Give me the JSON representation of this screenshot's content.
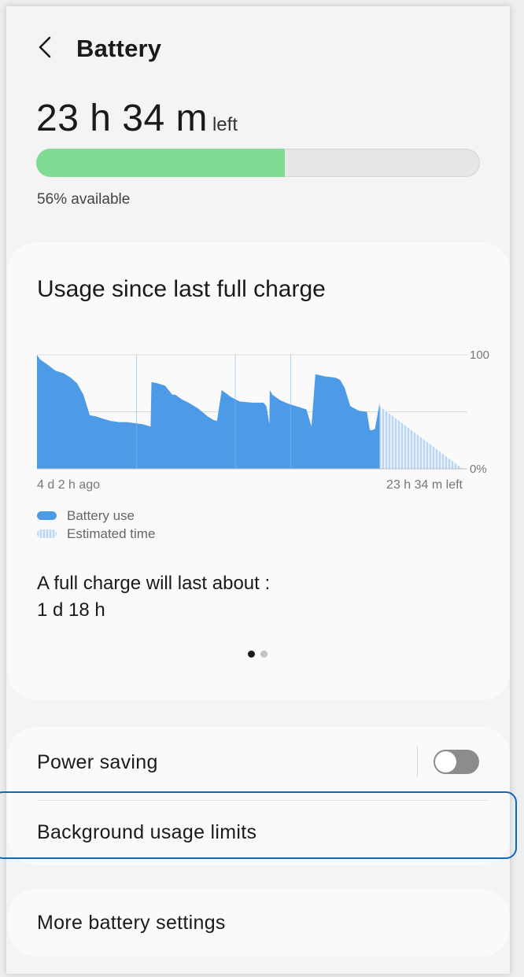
{
  "header": {
    "title": "Battery",
    "back_icon": "chevron-left-icon"
  },
  "battery": {
    "time_left_value": "23 h 34 m",
    "time_left_suffix": "left",
    "percent": 56,
    "available_text": "56% available",
    "fill_color": "#80dc92"
  },
  "usage": {
    "title": "Usage since last full charge",
    "full_charge_label": "A full charge will last about :",
    "full_charge_value": "1 d 18 h",
    "page_dots": {
      "count": 2,
      "active": 0
    }
  },
  "chart_data": {
    "type": "area",
    "y_tick_labels": [
      "100",
      "0%"
    ],
    "ylim": [
      0,
      100
    ],
    "gridlines": [
      0,
      50,
      100
    ],
    "x_start_label": "4 d 2 h ago",
    "x_end_label": "23 h 34 m left",
    "xlim": [
      0,
      100
    ],
    "series": [
      {
        "name": "Battery use",
        "color": "#4d9be6",
        "x": [
          0,
          0.7,
          2.6,
          4.3,
          6.2,
          7.9,
          9.4,
          10.9,
          12.4,
          13.8,
          15.5,
          17.3,
          19.3,
          21.1,
          23.1,
          24.9,
          26.7,
          26.9,
          28.3,
          30.1,
          31.8,
          32.5,
          34.0,
          35.6,
          37.8,
          40.1,
          41.4,
          42.3,
          43.4,
          45.6,
          47.6,
          50.6,
          53.2,
          53.9,
          54.6,
          54.7,
          55.3,
          57.2,
          59.1,
          61.7,
          63.3,
          64.5,
          65.4,
          67.8,
          70.1,
          71.2,
          72.3,
          73.6,
          75.6,
          77.5,
          78.2,
          78.8,
          79.4,
          80.5
        ],
        "y": [
          100,
          96,
          91,
          86,
          84,
          80,
          75,
          65,
          47,
          46,
          44,
          42,
          41,
          41,
          40,
          39,
          37,
          76,
          75,
          73,
          65,
          65,
          61,
          58,
          53,
          46,
          43,
          42,
          69,
          63,
          59,
          58,
          58,
          55,
          39,
          69,
          65,
          60,
          57,
          54,
          52,
          37,
          83,
          81,
          80,
          78,
          71,
          55,
          51,
          50,
          34,
          34,
          35,
          58
        ]
      },
      {
        "name": "Estimated time",
        "color": "#cfe3f8",
        "x": [
          80.5,
          100
        ],
        "y": [
          55,
          0
        ]
      }
    ],
    "legend": [
      "Battery use",
      "Estimated time"
    ],
    "legend_position": "bottom-left",
    "grid": true
  },
  "settings": {
    "power_saving_label": "Power saving",
    "power_saving_on": false,
    "background_usage_label": "Background usage limits",
    "more_settings_label": "More battery settings"
  },
  "colors": {
    "accent_blue": "#4d9be6",
    "highlight_outline": "#1067b8",
    "toggle_off": "#8c8c8c"
  }
}
